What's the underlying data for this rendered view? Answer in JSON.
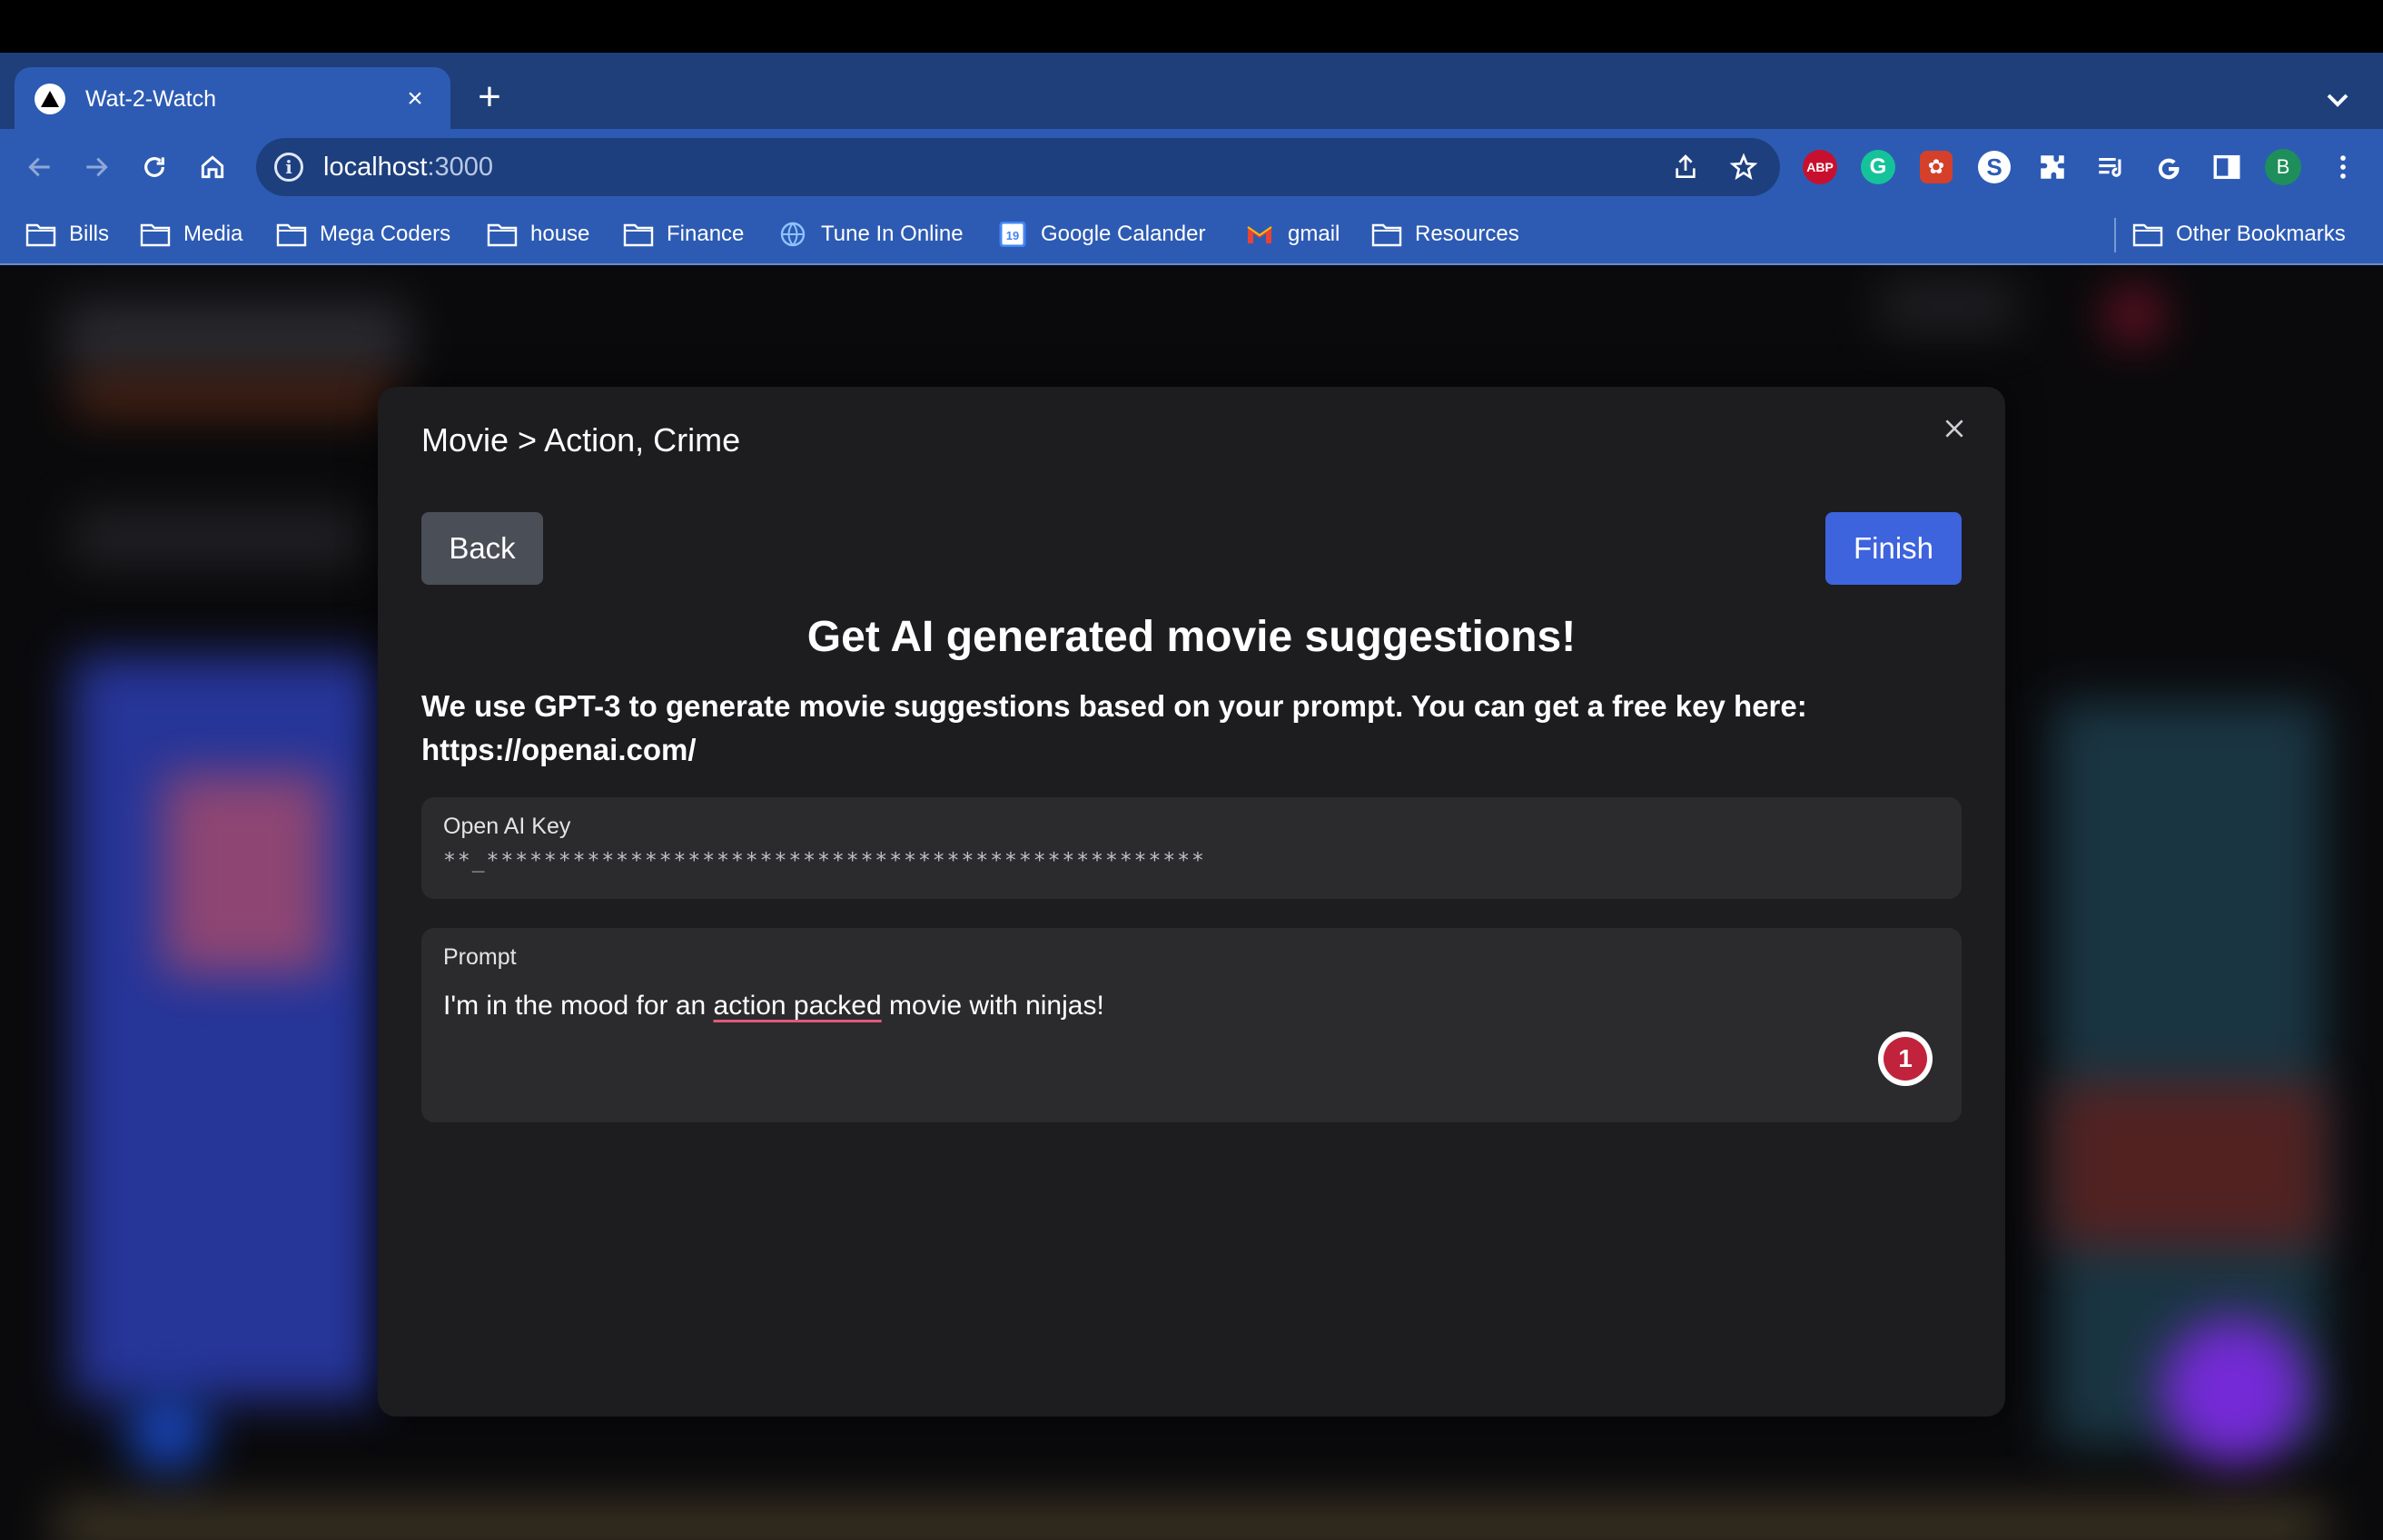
{
  "browser": {
    "tab_title": "Wat-2-Watch",
    "tab_close": "×",
    "new_tab": "+",
    "url_host": "localhost",
    "url_port": ":3000",
    "extensions": {
      "abp": "ABP",
      "grammarly": "G",
      "s_ext": "S"
    },
    "profile_initial": "B"
  },
  "bookmarks": [
    {
      "label": "Bills",
      "icon": "folder-icon"
    },
    {
      "label": "Media",
      "icon": "folder-icon"
    },
    {
      "label": "Mega Coders",
      "icon": "folder-icon"
    },
    {
      "label": "house",
      "icon": "folder-icon"
    },
    {
      "label": "Finance",
      "icon": "folder-icon"
    },
    {
      "label": "Tune In Online",
      "icon": "globe-icon"
    },
    {
      "label": "Google Calander",
      "icon": "calendar-icon"
    },
    {
      "label": "gmail",
      "icon": "gmail-icon"
    },
    {
      "label": "Resources",
      "icon": "folder-icon"
    }
  ],
  "other_bookmarks": "Other Bookmarks",
  "calendar_day": "19",
  "modal": {
    "breadcrumb": "Movie > Action, Crime",
    "back_label": "Back",
    "finish_label": "Finish",
    "heading": "Get AI generated movie suggestions!",
    "description": "We use GPT-3 to generate movie suggestions based on your prompt. You can get a free key here: https://openai.com/",
    "key_field": {
      "label": "Open AI Key",
      "value": "**_**************************************************"
    },
    "prompt_field": {
      "label": "Prompt",
      "value_before": "I'm in the mood for an ",
      "value_misspelled": "action packed",
      "value_after": " movie with ninjas!",
      "issue_count": "1"
    }
  },
  "colors": {
    "tabstrip": "#1e3f7a",
    "toolbar": "#2d5bb3",
    "modal_bg": "#1d1d1f",
    "finish_button": "#3d63dd",
    "back_button": "#4a4e57"
  }
}
